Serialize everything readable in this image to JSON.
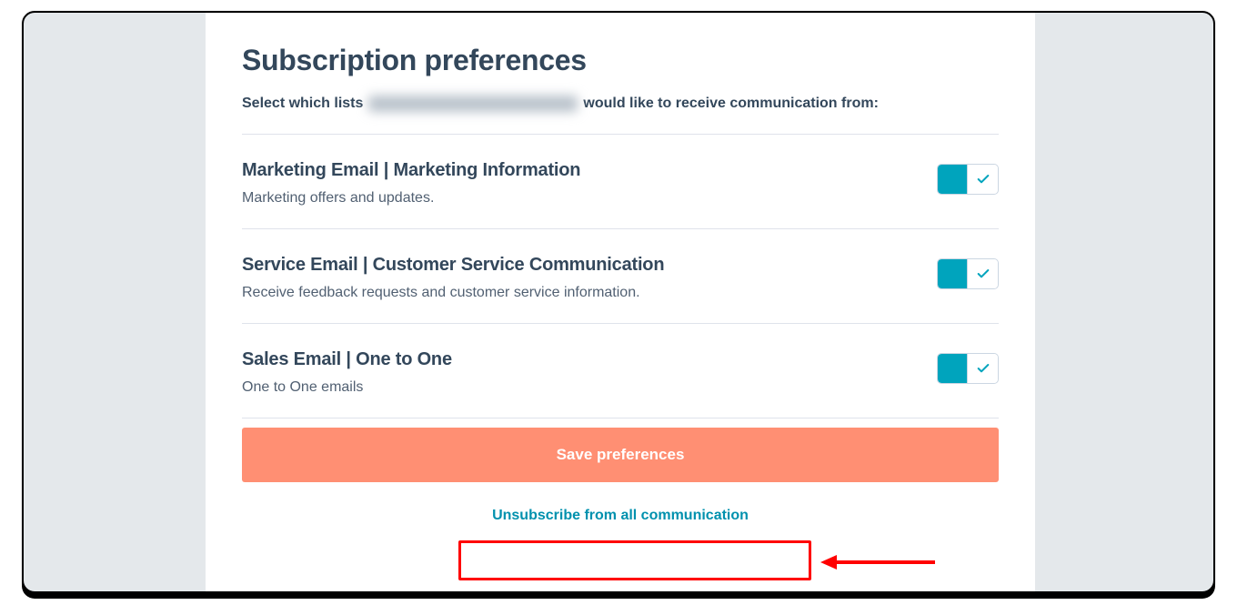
{
  "page": {
    "title": "Subscription preferences",
    "lead_prefix": "Select which lists",
    "lead_suffix": "would like to receive communication from:"
  },
  "prefs": [
    {
      "title": "Marketing Email | Marketing Information",
      "desc": "Marketing offers and updates.",
      "on": true
    },
    {
      "title": "Service Email | Customer Service Communication",
      "desc": "Receive feedback requests and customer service information.",
      "on": true
    },
    {
      "title": "Sales Email | One to One",
      "desc": "One to One emails",
      "on": true
    }
  ],
  "actions": {
    "save": "Save preferences",
    "unsubscribe": "Unsubscribe from all communication"
  }
}
